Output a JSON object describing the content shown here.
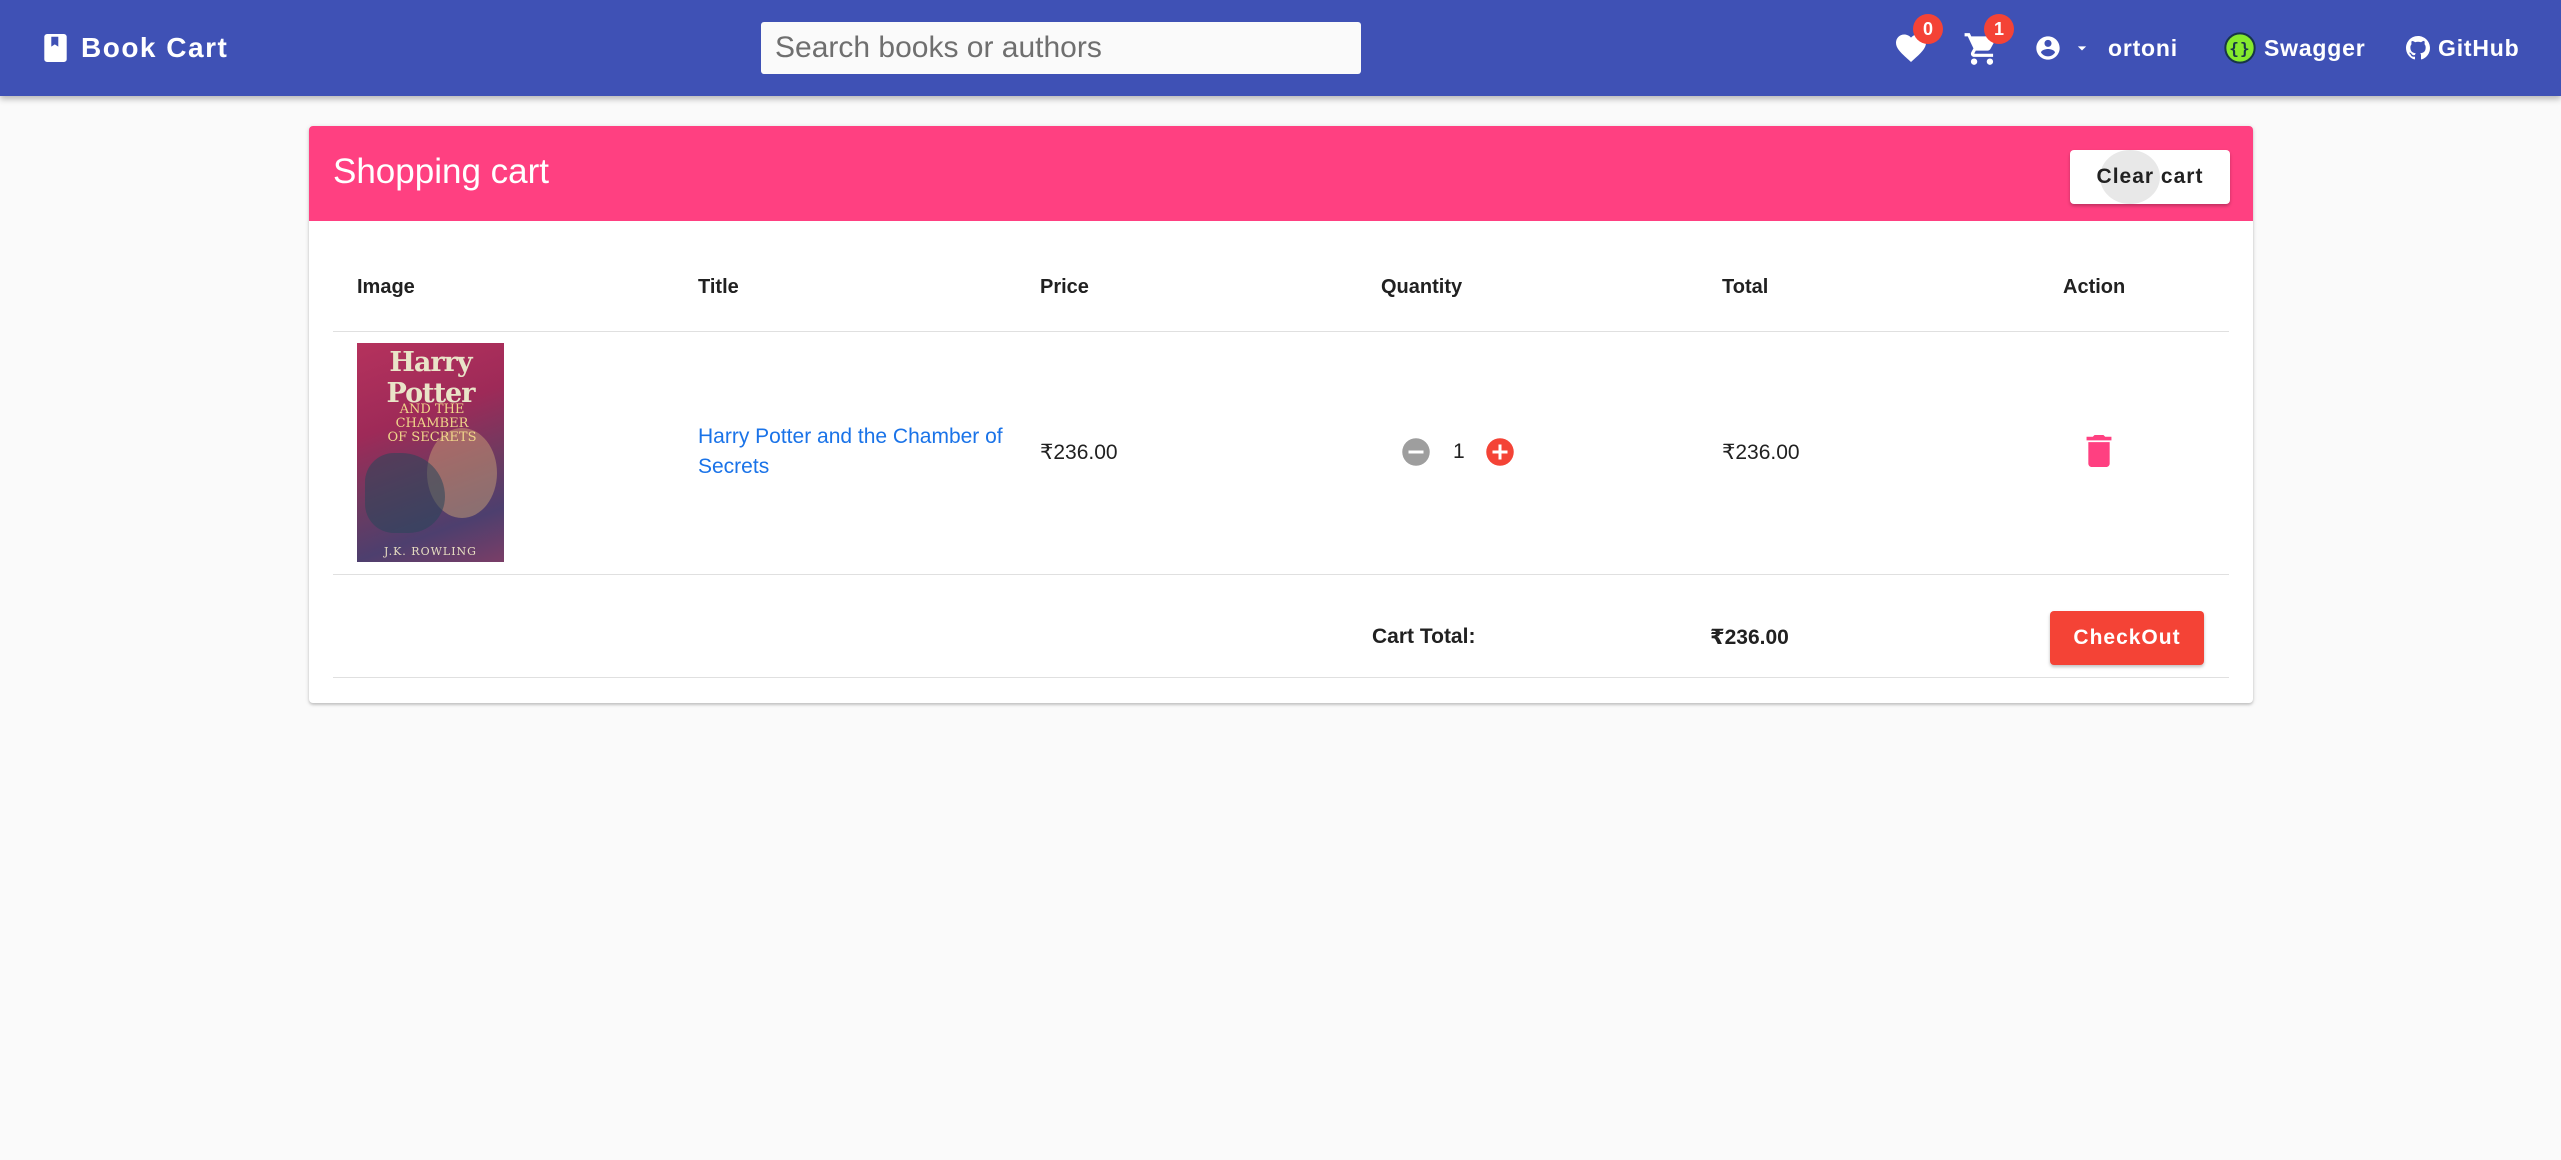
{
  "header": {
    "brand": "Book Cart",
    "brand_icon": "book-icon",
    "search_placeholder": "Search books or authors",
    "search_value": "",
    "wishlist": {
      "icon": "heart-icon",
      "count": "0"
    },
    "cart": {
      "icon": "cart-icon",
      "count": "1"
    },
    "user": {
      "icon": "account-circle-icon",
      "name": "ortoni"
    },
    "links": [
      {
        "label": "Swagger",
        "icon": "swagger-icon"
      },
      {
        "label": "GitHub",
        "icon": "github-icon"
      }
    ]
  },
  "cart": {
    "title": "Shopping cart",
    "clear_label": "Clear cart",
    "columns": [
      "Image",
      "Title",
      "Price",
      "Quantity",
      "Total",
      "Action"
    ],
    "items": [
      {
        "cover": {
          "title": "Harry Potter",
          "subtitle": "AND THE CHAMBER OF SECRETS",
          "author": "J.K. ROWLING"
        },
        "title": "Harry Potter and the Chamber of Secrets",
        "price": "₹236.00",
        "quantity": "1",
        "total": "₹236.00"
      }
    ],
    "total_label": "Cart Total:",
    "total_value": "₹236.00",
    "checkout_label": "CheckOut"
  },
  "colors": {
    "primary": "#3f51b5",
    "accent": "#ff4081",
    "warn": "#f44336",
    "link": "#1a73e8"
  }
}
